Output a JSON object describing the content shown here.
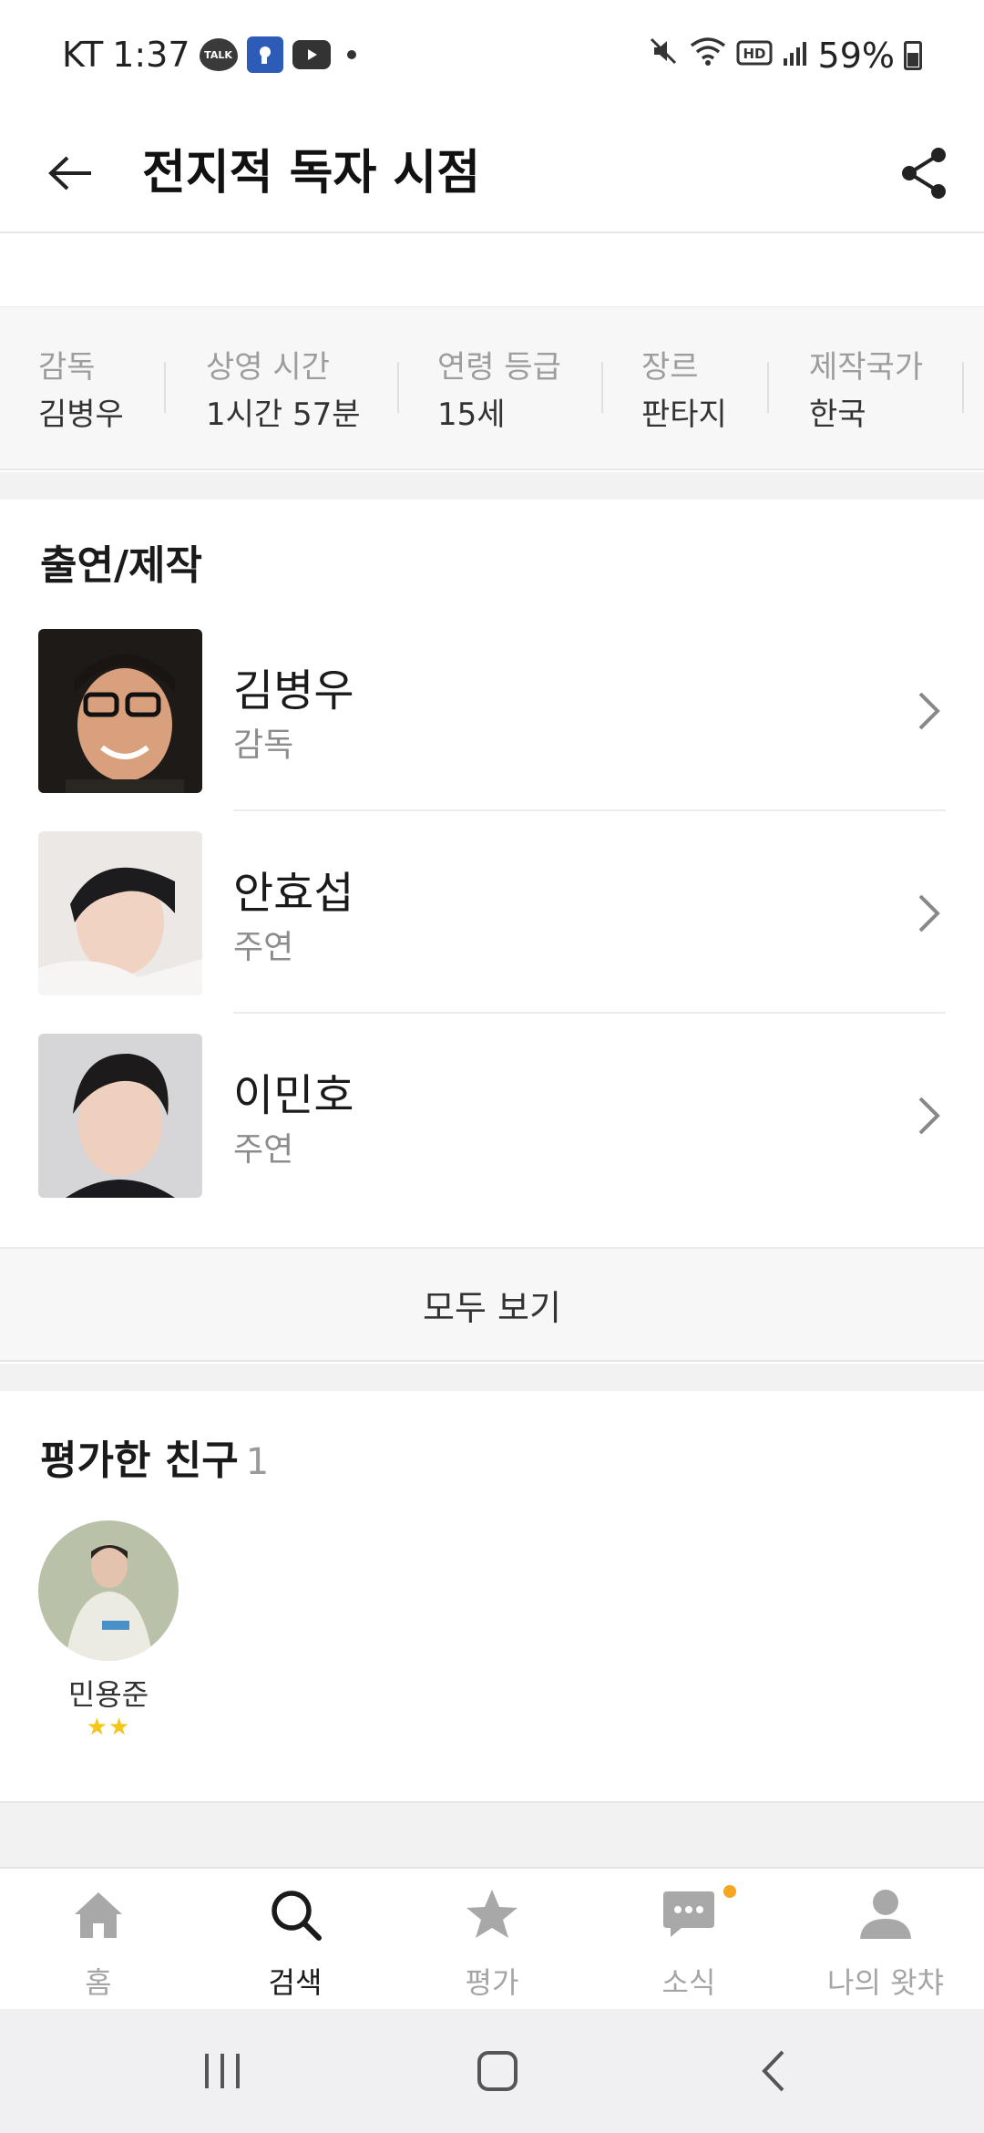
{
  "status_bar": {
    "carrier": "KT",
    "time": "1:37",
    "talk_label": "TALK",
    "battery": "59%"
  },
  "header": {
    "title": "전지적 독자 시점"
  },
  "info": [
    {
      "label": "감독",
      "value": "김병우"
    },
    {
      "label": "상영 시간",
      "value": "1시간 57분"
    },
    {
      "label": "연령 등급",
      "value": "15세"
    },
    {
      "label": "장르",
      "value": "판타지"
    },
    {
      "label": "제작국가",
      "value": "한국"
    }
  ],
  "cast": {
    "title": "출연/제작",
    "people": [
      {
        "name": "김병우",
        "role": "감독"
      },
      {
        "name": "안효섭",
        "role": "주연"
      },
      {
        "name": "이민호",
        "role": "주연"
      }
    ],
    "more_label": "모두 보기"
  },
  "friends": {
    "title": "평가한 친구",
    "count": "1",
    "list": [
      {
        "name": "민용준",
        "stars": "★★"
      }
    ]
  },
  "bottom_nav": [
    {
      "label": "홈",
      "icon": "home-icon"
    },
    {
      "label": "검색",
      "icon": "search-icon"
    },
    {
      "label": "평가",
      "icon": "star-icon"
    },
    {
      "label": "소식",
      "icon": "chat-icon"
    },
    {
      "label": "나의 왓챠",
      "icon": "person-icon"
    }
  ]
}
